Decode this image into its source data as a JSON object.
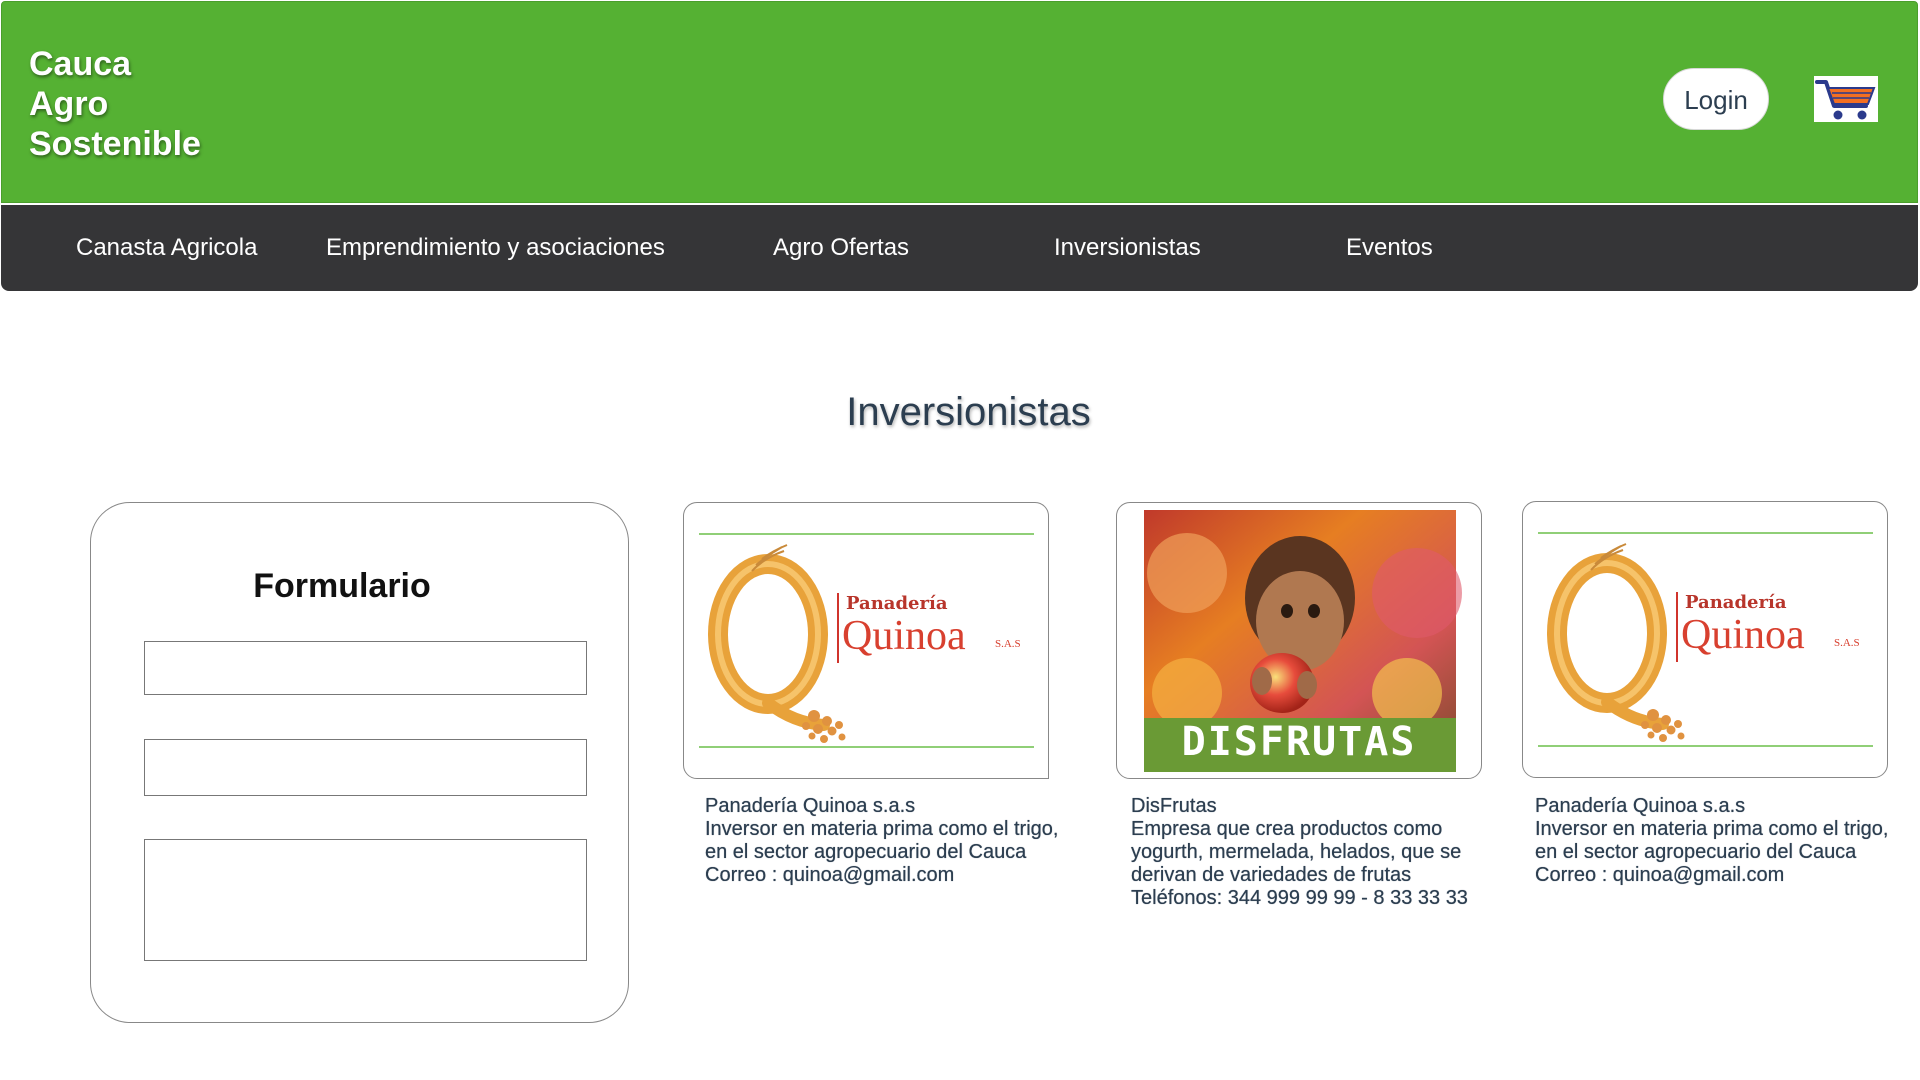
{
  "header": {
    "brand_lines": [
      "Cauca",
      "Agro",
      "Sostenible"
    ],
    "login_label": "Login",
    "cart_icon": "shopping-cart-icon",
    "background": "#55b133"
  },
  "nav": {
    "items": [
      {
        "label": "Canasta Agricola"
      },
      {
        "label": "Emprendimiento y asociaciones"
      },
      {
        "label": "Agro Ofertas"
      },
      {
        "label": "Inversionistas"
      },
      {
        "label": "Eventos"
      }
    ],
    "background": "#353537"
  },
  "main": {
    "title": "Inversionistas",
    "form": {
      "title": "Formulario",
      "fields": [
        {
          "value": "",
          "placeholder": ""
        },
        {
          "value": "",
          "placeholder": ""
        },
        {
          "value": "",
          "placeholder": ""
        }
      ]
    },
    "cards": [
      {
        "logo": {
          "small": "Panadería",
          "big": "Quinoa",
          "suffix": "S.A.S"
        },
        "lines": [
          "Panadería Quinoa s.a.s",
          "Inversor en materia prima como el trigo,",
          "en el sector agropecuario del Cauca",
          "Correo : quinoa@gmail.com"
        ]
      },
      {
        "logo": {
          "banner": "DISFRUTAS"
        },
        "lines": [
          "DisFrutas",
          "Empresa que crea productos como",
          "yogurth, mermelada, helados, que se",
          "derivan de variedades de frutas",
          "Teléfonos: 344 999 99 99 - 8 33 33 33"
        ]
      },
      {
        "logo": {
          "small": "Panadería",
          "big": "Quinoa",
          "suffix": "S.A.S"
        },
        "lines": [
          "Panadería Quinoa s.a.s",
          "Inversor en materia prima como el trigo,",
          "en el sector agropecuario del Cauca",
          "Correo : quinoa@gmail.com"
        ]
      }
    ]
  }
}
